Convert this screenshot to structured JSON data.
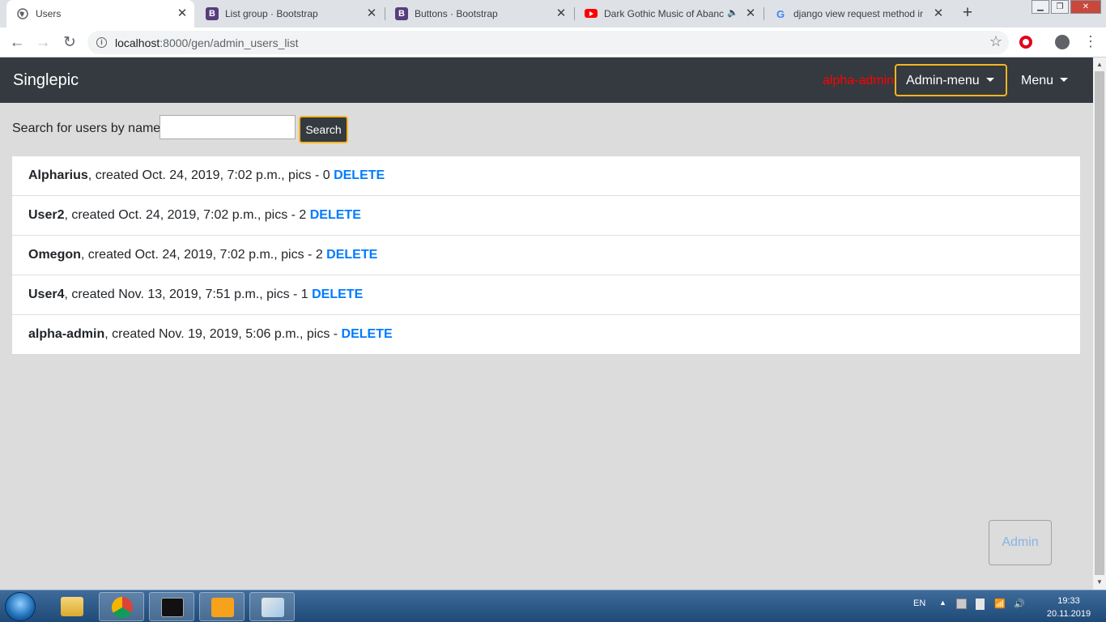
{
  "browser": {
    "tabs": [
      {
        "title": "Users",
        "favicon": "globe-icon"
      },
      {
        "title": "List group · Bootstrap",
        "favicon": "bootstrap-icon"
      },
      {
        "title": "Buttons · Bootstrap",
        "favicon": "bootstrap-icon"
      },
      {
        "title": "Dark Gothic Music of Abanc",
        "favicon": "youtube-icon"
      },
      {
        "title": "django view request method in",
        "favicon": "google-icon"
      }
    ],
    "url_host": "localhost",
    "url_path": ":8000/gen/admin_users_list"
  },
  "navbar": {
    "brand": "Singlepic",
    "current_user": "alpha-admin",
    "admin_menu_label": "Admin-menu",
    "menu_label": "Menu"
  },
  "search": {
    "label": "Search for users by name",
    "value": "",
    "button_label": "Search"
  },
  "users": [
    {
      "name": "Alpharius",
      "details": ", created Oct. 24, 2019, 7:02 p.m., pics - 0 ",
      "delete_label": "DELETE"
    },
    {
      "name": "User2",
      "details": ", created Oct. 24, 2019, 7:02 p.m., pics - 2 ",
      "delete_label": "DELETE"
    },
    {
      "name": "Omegon",
      "details": ", created Oct. 24, 2019, 7:02 p.m., pics - 2 ",
      "delete_label": "DELETE"
    },
    {
      "name": "User4",
      "details": ", created Nov. 13, 2019, 7:51 p.m., pics - 1 ",
      "delete_label": "DELETE"
    },
    {
      "name": "alpha-admin",
      "details": ", created Nov. 19, 2019, 5:06 p.m., pics - ",
      "delete_label": "DELETE"
    }
  ],
  "floating_button": "Admin",
  "taskbar": {
    "language": "EN",
    "time": "19:33",
    "date": "20.11.2019"
  },
  "colors": {
    "navbar": "#343a40",
    "accent_border": "#f3b61f",
    "link": "#007bff",
    "current_user": "#ff0000",
    "page_bg": "#dcdcdc"
  }
}
